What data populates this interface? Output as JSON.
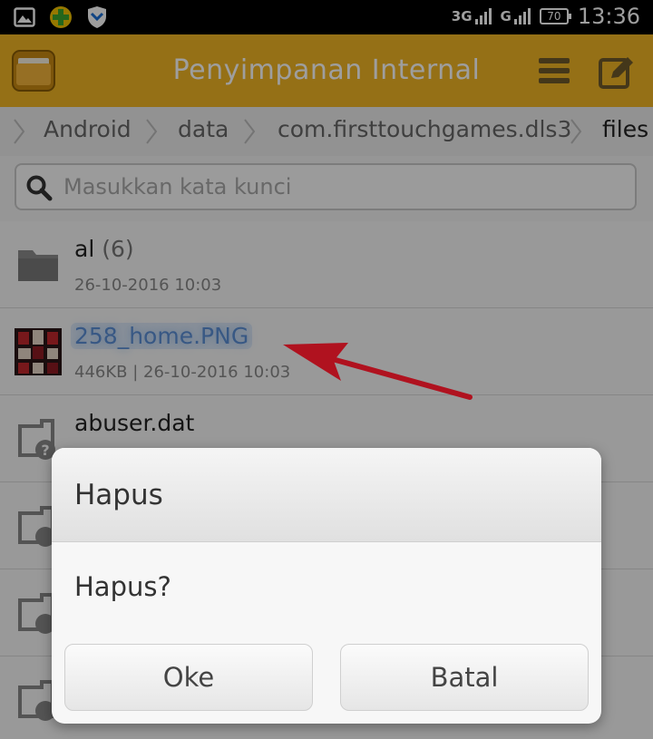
{
  "status_bar": {
    "icons": [
      "image-icon",
      "plus-badge-icon",
      "shield-icon"
    ],
    "network_1": "3G",
    "network_2": "G",
    "battery": "70",
    "time": "13:36"
  },
  "app_bar": {
    "title": "Penyimpanan Internal",
    "logo_icon": "folder-icon",
    "menu_icon": "menu-icon",
    "edit_icon": "edit-icon",
    "color": "#f0b524"
  },
  "breadcrumb": {
    "items": [
      "Android",
      "data",
      "com.firsttouchgames.dls3",
      "files"
    ]
  },
  "search": {
    "placeholder": "Masukkan kata kunci",
    "value": ""
  },
  "files": [
    {
      "name": "al",
      "count": "(6)",
      "meta": "26-10-2016 10:03",
      "icon": "folder-icon"
    },
    {
      "name": "258_home.PNG",
      "meta": "446KB | 26-10-2016 10:03",
      "icon": "image-thumbnail-icon"
    },
    {
      "name": "abuser.dat",
      "icon": "unknown-file-icon"
    },
    {
      "icon": "unknown-file-icon"
    },
    {
      "icon": "unknown-file-icon"
    },
    {
      "icon": "unknown-file-icon"
    }
  ],
  "dialog": {
    "title": "Hapus",
    "message": "Hapus?",
    "ok_label": "Oke",
    "cancel_label": "Batal"
  },
  "annotation": {
    "arrow_color": "#b0121f"
  }
}
